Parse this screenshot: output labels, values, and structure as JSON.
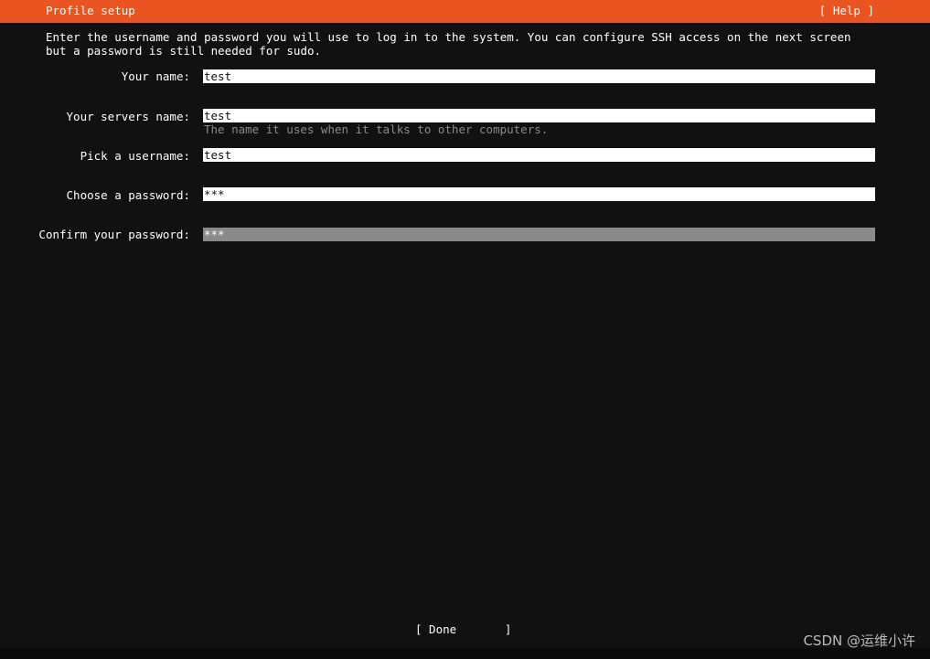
{
  "header": {
    "title": "Profile setup",
    "help_label": "[ Help ]",
    "background_color": "#e95420"
  },
  "intro": "Enter the username and password you will use to log in to the system. You can configure SSH access on the next screen but a password is still needed for sudo.",
  "fields": [
    {
      "label": "Your name:",
      "value": "test",
      "help": ""
    },
    {
      "label": "Your servers name:",
      "value": "test",
      "help": "The name it uses when it talks to other computers."
    },
    {
      "label": "Pick a username:",
      "value": "test",
      "help": ""
    },
    {
      "label": "Choose a password:",
      "value": "***",
      "help": ""
    },
    {
      "label": "Confirm your password:",
      "value": "***",
      "help": ""
    }
  ],
  "footer": {
    "done_label": "[ Done       ]"
  },
  "watermark": "CSDN @运维小许"
}
